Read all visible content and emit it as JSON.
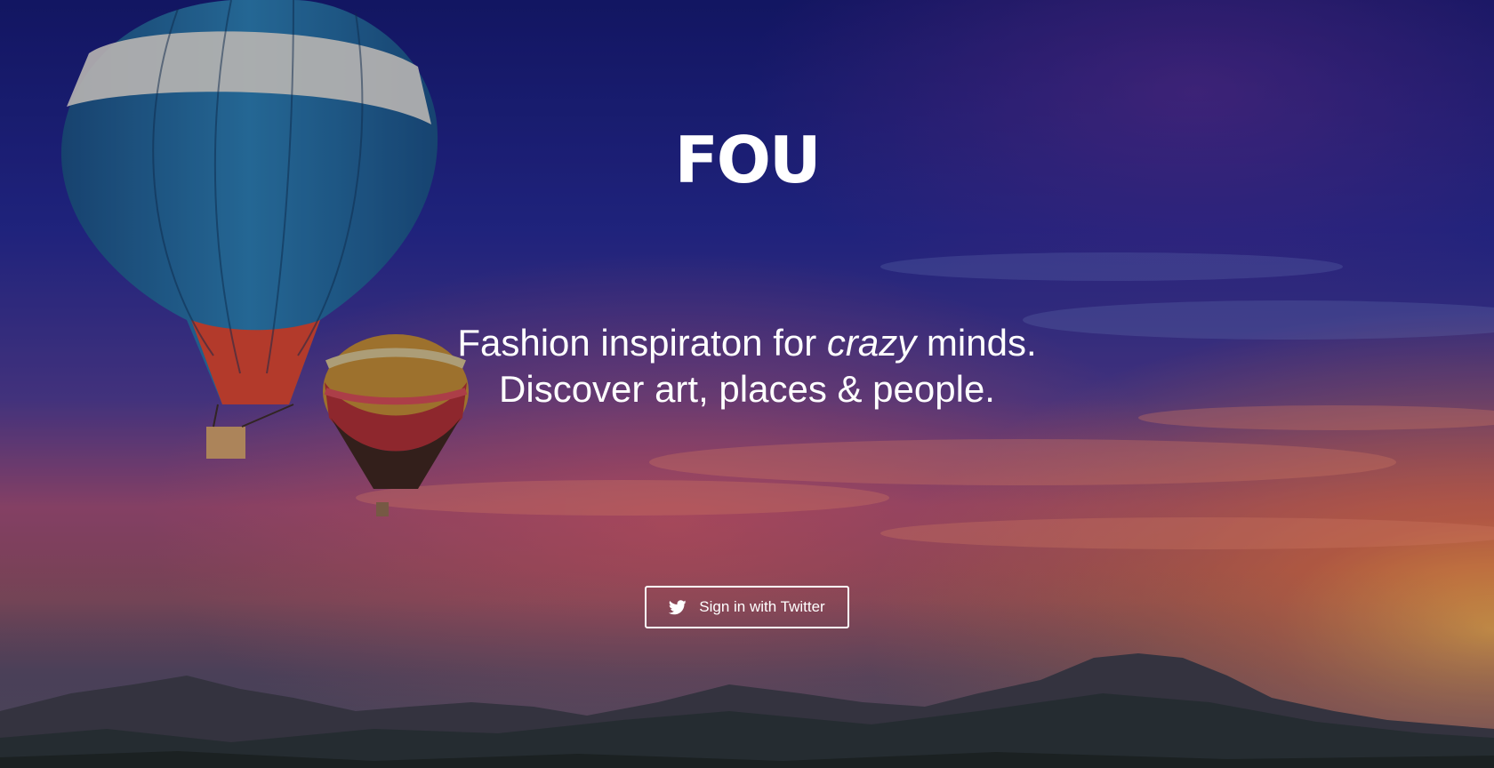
{
  "hero": {
    "logo": "FOU",
    "tagline_line1_prefix": "Fashion inspiraton for ",
    "tagline_line1_emphasis": "crazy",
    "tagline_line1_suffix": " minds.",
    "tagline_line2": "Discover art, places & people."
  },
  "signin": {
    "label": "Sign in with Twitter",
    "icon": "twitter-bird-icon"
  },
  "colors": {
    "text": "#ffffff",
    "sky_top": "#1b1f73",
    "sunset": "#e0603a"
  }
}
